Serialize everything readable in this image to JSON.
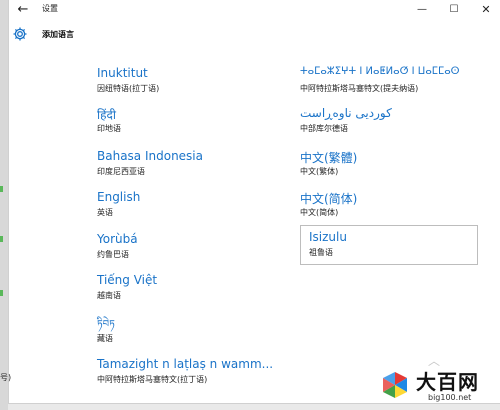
{
  "window": {
    "title": "设置",
    "back_icon": "back-arrow-icon",
    "minimize_symbol": "—",
    "maximize_symbol": "☐",
    "close_symbol": "✕"
  },
  "header": {
    "title": "添加语言",
    "icon": "gear-icon"
  },
  "languages_left": [
    {
      "name": "Inuktitut",
      "sub": "因纽特语(拉丁语)"
    },
    {
      "name": "हिंदी",
      "sub": "印地语"
    },
    {
      "name": "Bahasa Indonesia",
      "sub": "印度尼西亚语"
    },
    {
      "name": "English",
      "sub": "英语"
    },
    {
      "name": "Yorùbá",
      "sub": "约鲁巴语"
    },
    {
      "name": "Tiếng Việt",
      "sub": "越南语"
    },
    {
      "name": "ཏིབེཏ",
      "sub": "藏语"
    },
    {
      "name": "Tamazight n laṭlaṣ n wamm...",
      "sub": "中阿特拉斯塔马塞特文(拉丁语)"
    }
  ],
  "languages_right": [
    {
      "name": "ⵜⴰⵎⴰⵣⵉⵖⵜ ⵏ ⵍⴰⵟⵍⴰⵚ ⵏ ⵡⴰⵎⵎⴰⵙ",
      "sub": "中阿特拉斯塔马塞特文(提夫纳语)"
    },
    {
      "name": "کوردیی ناوەڕاست",
      "sub": "中部库尔德语"
    },
    {
      "name": "中文(繁體)",
      "sub": "中文(繁体)"
    },
    {
      "name": "中文(简体)",
      "sub": "中文(简体)"
    },
    {
      "name": "Isizulu",
      "sub": "祖鲁语"
    }
  ],
  "left_edge_fragment": "号)",
  "scroll_indicator": "︿",
  "watermark": {
    "big_text": "大百网",
    "url": "big100.net",
    "colors": [
      "#e53935",
      "#43a047",
      "#1e88e5",
      "#fdd835"
    ]
  },
  "accent_color": "#1a73c8"
}
